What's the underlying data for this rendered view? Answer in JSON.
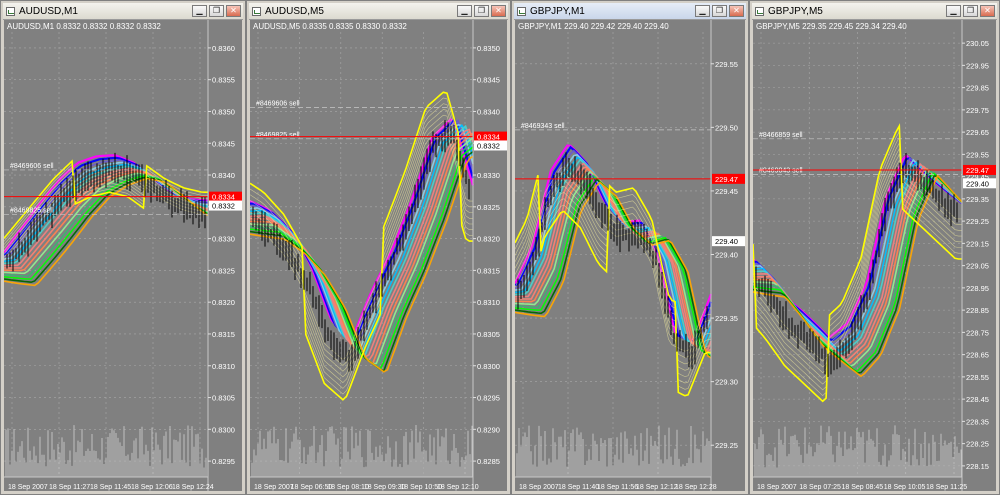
{
  "windows": [
    {
      "title": "AUDUSD,M1",
      "symbol_line": "AUDUSD,M1  0.8332 0.8332 0.8332 0.8332",
      "active": false,
      "price_labels": [
        "0.8360",
        "0.8355",
        "0.8350",
        "0.8345",
        "0.8340",
        "0.8335",
        "0.8330",
        "0.8325",
        "0.8320",
        "0.8315",
        "0.8310",
        "0.8305",
        "0.8300",
        "0.8295"
      ],
      "time_labels": [
        "18 Sep 2007",
        "18 Sep 11:27",
        "18 Sep 11:45",
        "18 Sep 12:06",
        "18 Sep 12:24"
      ],
      "orders": [
        {
          "label": "#8469606 sell"
        },
        {
          "label": "#8469825 sell"
        }
      ],
      "tags": {
        "red": "0.8334",
        "white": "0.8332"
      }
    },
    {
      "title": "AUDUSD,M5",
      "symbol_line": "AUDUSD,M5  0.8335 0.8335 0.8330 0.8332",
      "active": false,
      "price_labels": [
        "0.8350",
        "0.8345",
        "0.8340",
        "0.8335",
        "0.8330",
        "0.8325",
        "0.8320",
        "0.8315",
        "0.8310",
        "0.8305",
        "0.8300",
        "0.8295",
        "0.8290",
        "0.8285"
      ],
      "time_labels": [
        "18 Sep 2007",
        "18 Sep 06:50",
        "18 Sep 08:10",
        "18 Sep 09:30",
        "18 Sep 10:50",
        "18 Sep 12:10"
      ],
      "orders": [
        {
          "label": "#8469606 sell"
        },
        {
          "label": "#8469825 sell"
        }
      ],
      "tags": {
        "red": "0.8334",
        "white": "0.8332"
      }
    },
    {
      "title": "GBPJPY,M1",
      "symbol_line": "GBPJPY,M1  229.40 229.42 229.40 229.40",
      "active": true,
      "price_labels": [
        "229.55",
        "229.50",
        "229.45",
        "229.40",
        "229.35",
        "229.30",
        "229.25"
      ],
      "time_labels": [
        "18 Sep 2007",
        "18 Sep 11:40",
        "18 Sep 11:56",
        "18 Sep 12:12",
        "18 Sep 12:28"
      ],
      "orders": [
        {
          "label": "#8469343 sell"
        }
      ],
      "tags": {
        "red": "229.47",
        "white": "229.40"
      }
    },
    {
      "title": "GBPJPY,M5",
      "symbol_line": "GBPJPY,M5  229.35 229.45 229.34 229.40",
      "active": false,
      "price_labels": [
        "230.05",
        "229.95",
        "229.85",
        "229.75",
        "229.65",
        "229.55",
        "229.45",
        "229.35",
        "229.25",
        "229.15",
        "229.05",
        "228.95",
        "228.85",
        "228.75",
        "228.65",
        "228.55",
        "228.45",
        "228.35",
        "228.25",
        "228.15"
      ],
      "time_labels": [
        "18 Sep 2007",
        "18 Sep 07:25",
        "18 Sep 08:45",
        "18 Sep 10:05",
        "18 Sep 11:25"
      ],
      "orders": [
        {
          "label": "#8466859 sell"
        },
        {
          "label": "#8469043 sell"
        }
      ],
      "tags": {
        "red": "229.47",
        "white": "229.40"
      }
    }
  ],
  "controls": {
    "minimize": "▁",
    "restore": "❐",
    "close": "✕"
  },
  "colors": {
    "chart_bg": "#808080",
    "grid": "#a8a8a8",
    "candle": "#000000",
    "volume": "#c0c0c0",
    "envelope": "#ffff00",
    "order_line": "#ff0000",
    "bands": [
      "#ff00ff",
      "#0000ff",
      "#6a5acd",
      "#87ceeb",
      "#00bfff",
      "#48d1cc",
      "#f08080",
      "#fa8072",
      "#ff7f50",
      "#90ee90",
      "#3cb371",
      "#00ff00",
      "#006400",
      "#ffa500"
    ]
  }
}
